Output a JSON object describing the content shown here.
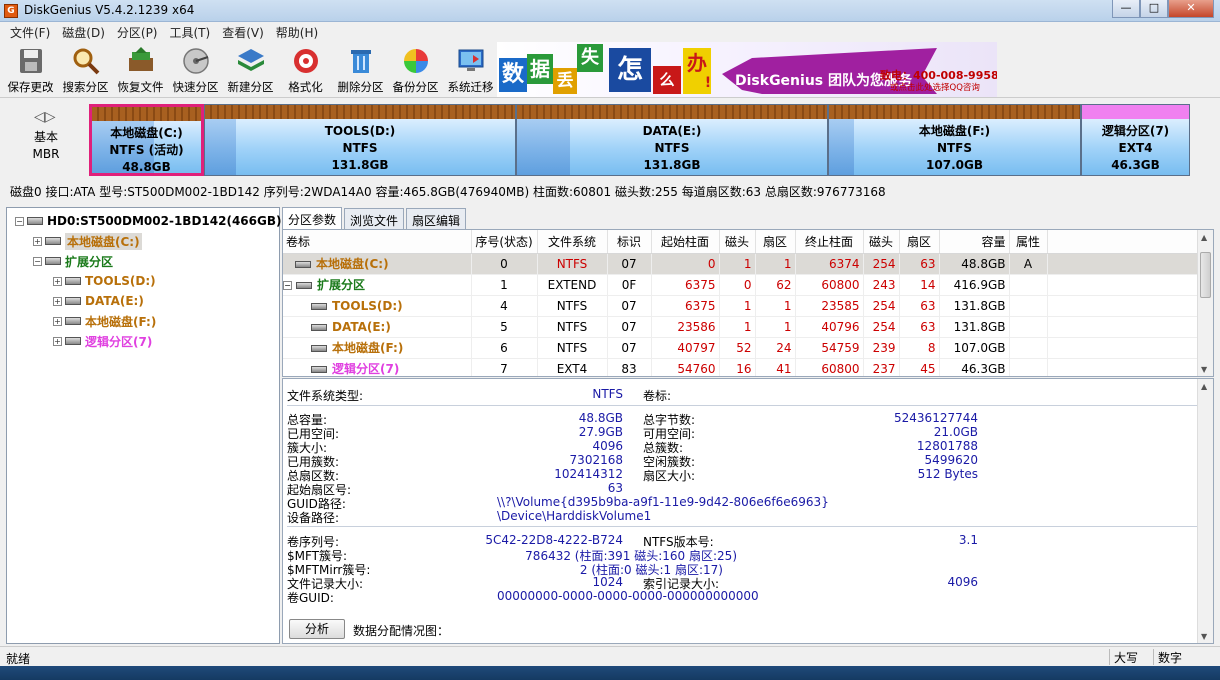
{
  "window": {
    "title": "DiskGenius V5.4.2.1239 x64",
    "icon_glyph": "G",
    "min": "—",
    "max": "□",
    "close": "✕"
  },
  "menu": [
    "文件(F)",
    "磁盘(D)",
    "分区(P)",
    "工具(T)",
    "查看(V)",
    "帮助(H)"
  ],
  "toolbar": [
    {
      "label": "保存更改",
      "icon": "save-icon"
    },
    {
      "label": "搜索分区",
      "icon": "search-icon"
    },
    {
      "label": "恢复文件",
      "icon": "recover-icon"
    },
    {
      "label": "快速分区",
      "icon": "quick-partition-icon"
    },
    {
      "label": "新建分区",
      "icon": "new-partition-icon"
    },
    {
      "label": "格式化",
      "icon": "format-icon"
    },
    {
      "label": "删除分区",
      "icon": "delete-icon"
    },
    {
      "label": "备份分区",
      "icon": "backup-icon"
    },
    {
      "label": "系统迁移",
      "icon": "migrate-icon"
    }
  ],
  "banner": {
    "chars": [
      "数",
      "据",
      "丢",
      "失",
      "怎",
      "么",
      "办",
      "!"
    ],
    "slogan": "DiskGenius 团队为您服务",
    "phone": "致电：400-008-9958",
    "qq": "或点击此处选择QQ咨询"
  },
  "diskmap": {
    "type_line1": "基本",
    "type_line2": "MBR",
    "nav_left": "◁",
    "nav_right": "▷",
    "partitions": [
      {
        "name": "本地磁盘(C:)",
        "fs": "NTFS (活动)",
        "size": "48.8GB",
        "used_fraction": 0.57,
        "selected": true
      },
      {
        "name": "TOOLS(D:)",
        "fs": "NTFS",
        "size": "131.8GB",
        "used_fraction": 0.1
      },
      {
        "name": "DATA(E:)",
        "fs": "NTFS",
        "size": "131.8GB",
        "used_fraction": 0.17
      },
      {
        "name": "本地磁盘(F:)",
        "fs": "NTFS",
        "size": "107.0GB",
        "used_fraction": 0.1
      },
      {
        "name": "逻辑分区(7)",
        "fs": "EXT4",
        "size": "46.3GB",
        "used_fraction": 0.0,
        "bar_color": "#f080f0"
      }
    ]
  },
  "disk_info": "磁盘0 接口:ATA  型号:ST500DM002-1BD142  序列号:2WDA14A0  容量:465.8GB(476940MB)  柱面数:60801  磁头数:255  每道扇区数:63  总扇区数:976773168",
  "tree": {
    "root": "HD0:ST500DM002-1BD142(466GB)",
    "items": [
      {
        "label": "本地磁盘(C:)",
        "color": "#b8700a",
        "selected": true
      },
      {
        "label": "扩展分区",
        "color": "#1a7a1a"
      },
      {
        "label": "TOOLS(D:)",
        "color": "#b8700a"
      },
      {
        "label": "DATA(E:)",
        "color": "#b8700a"
      },
      {
        "label": "本地磁盘(F:)",
        "color": "#b8700a"
      },
      {
        "label": "逻辑分区(7)",
        "color": "#e040e0"
      }
    ]
  },
  "tabs": [
    "分区参数",
    "浏览文件",
    "扇区编辑"
  ],
  "table": {
    "headers": [
      "卷标",
      "序号(状态)",
      "文件系统",
      "标识",
      "起始柱面",
      "磁头",
      "扇区",
      "终止柱面",
      "磁头",
      "扇区",
      "容量",
      "属性"
    ],
    "rows": [
      {
        "label": "本地磁盘(C:)",
        "indent": 0,
        "color": "#b8700a",
        "cells": [
          "0",
          "NTFS",
          "07",
          "0",
          "1",
          "1",
          "6374",
          "254",
          "63",
          "48.8GB",
          "A"
        ],
        "selected": true
      },
      {
        "label": "扩展分区",
        "indent": 0,
        "color": "#1a7a1a",
        "cells": [
          "1",
          "EXTEND",
          "0F",
          "6375",
          "0",
          "62",
          "60800",
          "243",
          "14",
          "416.9GB",
          ""
        ],
        "expander": "−"
      },
      {
        "label": "TOOLS(D:)",
        "indent": 1,
        "color": "#b8700a",
        "cells": [
          "4",
          "NTFS",
          "07",
          "6375",
          "1",
          "1",
          "23585",
          "254",
          "63",
          "131.8GB",
          ""
        ]
      },
      {
        "label": "DATA(E:)",
        "indent": 1,
        "color": "#b8700a",
        "cells": [
          "5",
          "NTFS",
          "07",
          "23586",
          "1",
          "1",
          "40796",
          "254",
          "63",
          "131.8GB",
          ""
        ]
      },
      {
        "label": "本地磁盘(F:)",
        "indent": 1,
        "color": "#b8700a",
        "cells": [
          "6",
          "NTFS",
          "07",
          "40797",
          "52",
          "24",
          "54759",
          "239",
          "8",
          "107.0GB",
          ""
        ]
      },
      {
        "label": "逻辑分区(7)",
        "indent": 1,
        "color": "#e040e0",
        "cells": [
          "7",
          "EXT4",
          "83",
          "54760",
          "16",
          "41",
          "60800",
          "237",
          "45",
          "46.3GB",
          ""
        ]
      }
    ]
  },
  "details": {
    "fs_type_label": "文件系统类型:",
    "fs_type": "NTFS",
    "vol_label_label": "卷标:",
    "total_label": "总容量:",
    "total": "48.8GB",
    "total_bytes_label": "总字节数:",
    "total_bytes": "52436127744",
    "used_label": "已用空间:",
    "used": "27.9GB",
    "free_label": "可用空间:",
    "free": "21.0GB",
    "cluster_label": "簇大小:",
    "cluster": "4096",
    "clusters_label": "总簇数:",
    "clusters": "12801788",
    "used_clusters_label": "已用簇数:",
    "used_clusters": "7302168",
    "free_clusters_label": "空闲簇数:",
    "free_clusters": "5499620",
    "sectors_label": "总扇区数:",
    "sectors": "102414312",
    "sector_size_label": "扇区大小:",
    "sector_size": "512 Bytes",
    "start_sector_label": "起始扇区号:",
    "start_sector": "63",
    "guid_path_label": "GUID路径:",
    "guid_path": "\\\\?\\Volume{d395b9ba-a9f1-11e9-9d42-806e6f6e6963}",
    "device_path_label": "设备路径:",
    "device_path": "\\Device\\HarddiskVolume1",
    "serial_label": "卷序列号:",
    "serial": "5C42-22D8-4222-B724",
    "ntfs_ver_label": "NTFS版本号:",
    "ntfs_ver": "3.1",
    "mft_label": "$MFT簇号:",
    "mft": "786432 (柱面:391 磁头:160 扇区:25)",
    "mftmirr_label": "$MFTMirr簇号:",
    "mftmirr": "2 (柱面:0 磁头:1 扇区:17)",
    "frs_label": "文件记录大小:",
    "frs": "1024",
    "irs_label": "索引记录大小:",
    "irs": "4096",
    "vguid_label": "卷GUID:",
    "vguid": "00000000-0000-0000-0000-000000000000",
    "analyze_button": "分析",
    "alloc_label": "数据分配情况图："
  },
  "statusbar": {
    "status": "就绪",
    "caps": "大写",
    "num": "数字"
  },
  "colors": {
    "accent": "#e0207a",
    "orange_label": "#b8700a",
    "green_label": "#1a7a1a",
    "magenta_label": "#e040e0",
    "value_blue": "#1a1aa6",
    "red_value": "#cc0000"
  }
}
